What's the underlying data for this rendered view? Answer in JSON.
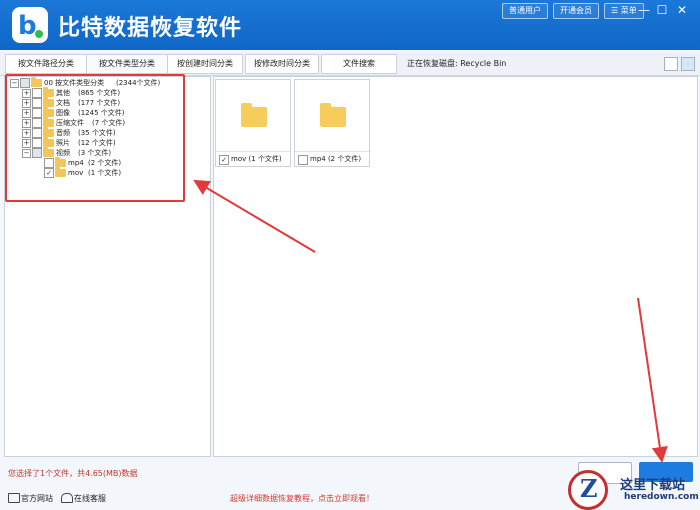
{
  "app": {
    "title": "比特数据恢复软件",
    "logo_letter": "b"
  },
  "title_bar": {
    "buttons": [
      "普通用户",
      "开通会员",
      "菜单"
    ],
    "window_controls": {
      "minimize": "—",
      "maximize": "☐",
      "close": "✕"
    }
  },
  "tabs": [
    "按文件路径分类",
    "按文件类型分类",
    "按创建时间分类",
    "按修改时间分类",
    "文件搜索"
  ],
  "status_label": "正在恢复磁盘: Recycle Bin",
  "tree": {
    "root": {
      "label": "00  按文件类型分类",
      "count": "(2344个文件)"
    },
    "items": [
      {
        "label": "其他",
        "count": "(865 个文件)"
      },
      {
        "label": "文档",
        "count": "(177 个文件)"
      },
      {
        "label": "图像",
        "count": "(1245 个文件)"
      },
      {
        "label": "压缩文件",
        "count": "(7 个文件)"
      },
      {
        "label": "音频",
        "count": "(35 个文件)"
      },
      {
        "label": "照片",
        "count": "(12 个文件)"
      },
      {
        "label": "视频",
        "count": "(3 个文件)"
      }
    ],
    "video_children": [
      {
        "label": "mp4",
        "count": "(2 个文件)",
        "checked": false
      },
      {
        "label": "mov",
        "count": "(1 个文件)",
        "checked": true
      }
    ]
  },
  "cards": [
    {
      "label": "mov (1 个文件)",
      "checked": true
    },
    {
      "label": "mp4 (2 个文件)",
      "checked": false
    }
  ],
  "selection_status": "您选择了1个文件，共4.65(MB)数据",
  "footer": {
    "website": "官方网站",
    "support": "在线客服",
    "promo": "超级详细数据恢复教程，点击立即观看！"
  },
  "watermark": {
    "letter": "Z",
    "name": "这里下载站",
    "url": "heredown.com"
  },
  "colors": {
    "brand": "#1c78d8",
    "highlight": "#e03a3a",
    "folder": "#f3c65a"
  }
}
